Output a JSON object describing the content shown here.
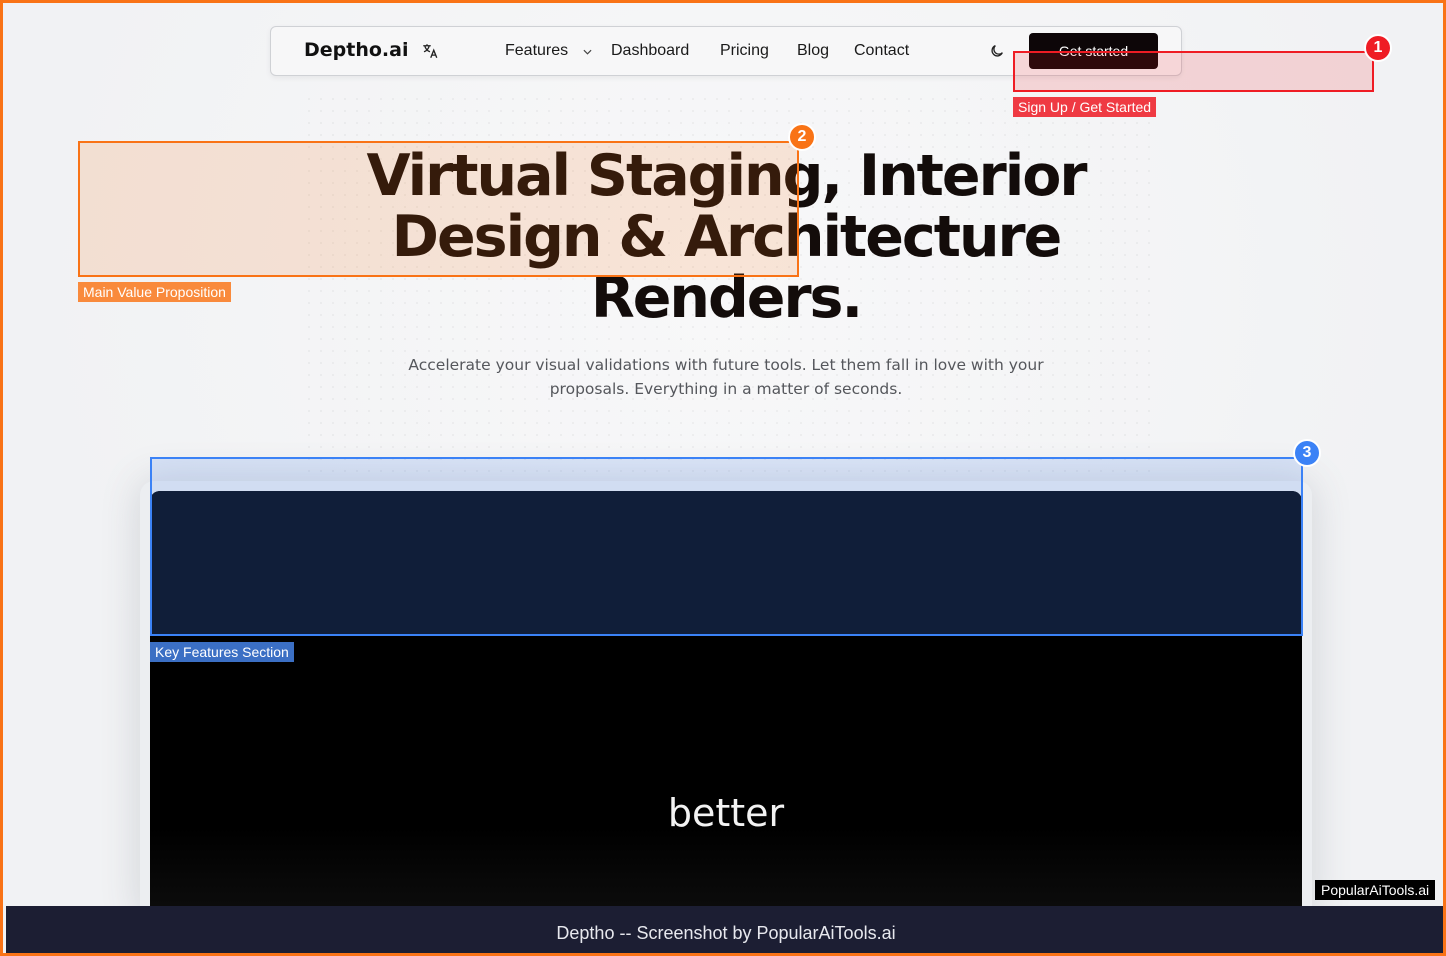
{
  "navbar": {
    "logo": "Deptho.ai",
    "items": [
      {
        "label": "Features"
      },
      {
        "label": "Dashboard"
      },
      {
        "label": "Pricing"
      },
      {
        "label": "Blog"
      },
      {
        "label": "Contact"
      }
    ],
    "cta_label": "Get started",
    "icons": [
      "translate-icon",
      "chevron-down-icon",
      "moon-icon"
    ]
  },
  "hero": {
    "title_lines": [
      "Virtual Staging, Interior",
      "Design & Architecture",
      "Renders."
    ],
    "subtitle_lines": [
      "Accelerate your visual validations with future tools. Let them fall in love with your",
      "proposals. Everything in a matter of seconds."
    ]
  },
  "video": {
    "word": "better"
  },
  "annotations": [
    {
      "number": "1",
      "label": "Sign Up / Get Started",
      "color": "#ef1c24"
    },
    {
      "number": "2",
      "label": "Main Value Proposition",
      "color": "#f97316"
    },
    {
      "number": "3",
      "label": "Key Features Section",
      "color": "#3b82f6"
    }
  ],
  "watermark": "PopularAiTools.ai",
  "footer": "Deptho -- Screenshot by PopularAiTools.ai",
  "colors": {
    "frame_border": "#f97316",
    "cta_bg": "#0d0608",
    "footer_bg": "#1c1e33"
  }
}
